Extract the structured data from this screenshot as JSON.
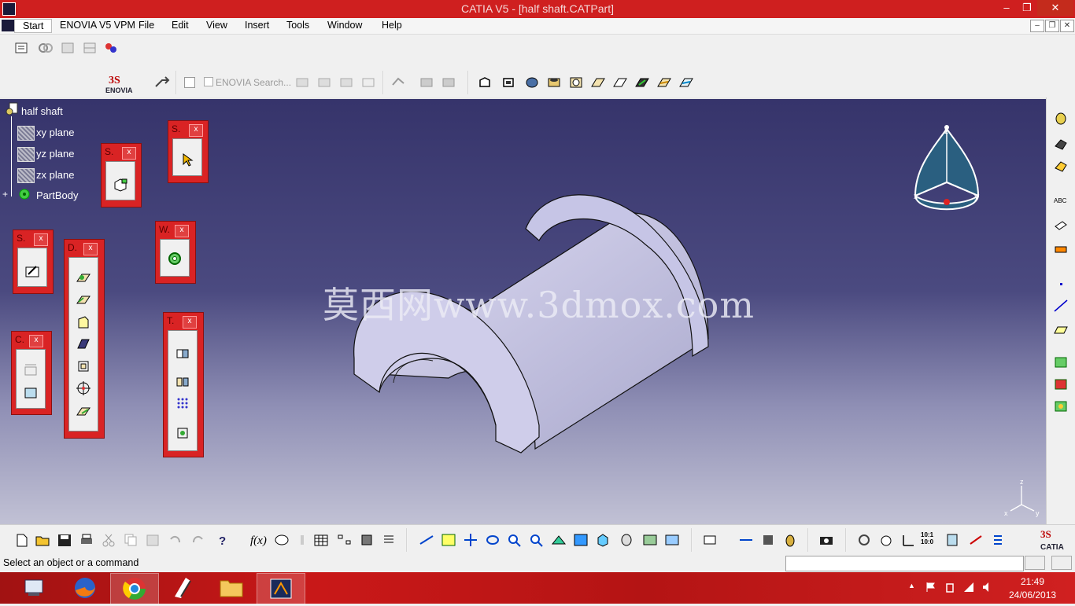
{
  "window": {
    "title": "CATIA V5 - [half shaft.CATPart]",
    "minimize_glyph": "–",
    "restore_glyph": "❐",
    "close_glyph": "✕"
  },
  "menubar": {
    "items": [
      {
        "label": "Start"
      },
      {
        "label": "ENOVIA V5 VPM"
      },
      {
        "label": "File"
      },
      {
        "label": "Edit"
      },
      {
        "label": "View"
      },
      {
        "label": "Insert"
      },
      {
        "label": "Tools"
      },
      {
        "label": "Window"
      },
      {
        "label": "Help"
      }
    ],
    "doc_min": "–",
    "doc_restore": "❐",
    "doc_close": "✕"
  },
  "toolbar": {
    "enovia_search_label": "ENOVIA Search...",
    "enovia_logo_text": "ENOVIA"
  },
  "tree": {
    "root": "half shaft",
    "items": [
      {
        "label": "xy plane"
      },
      {
        "label": "yz plane"
      },
      {
        "label": "zx plane"
      },
      {
        "label": "PartBody"
      }
    ]
  },
  "floating_toolbars": [
    {
      "title": "S.",
      "close": "x"
    },
    {
      "title": "S.",
      "close": "x"
    },
    {
      "title": "S.",
      "close": "x"
    },
    {
      "title": "D.",
      "close": "x"
    },
    {
      "title": "W.",
      "close": "x"
    },
    {
      "title": "C.",
      "close": "x"
    },
    {
      "title": "T.",
      "close": "x"
    }
  ],
  "viewport": {
    "watermark": "莫西网www.3dmox.com",
    "compass": {
      "z": "z",
      "x": "x",
      "y": "y"
    },
    "axis": {
      "z": "z",
      "x": "x",
      "y": "y"
    }
  },
  "bottom_toolbar": {
    "catia_logo_text": "CATIA",
    "fx_label": "f(x)",
    "scale_label": "10:1 10:0"
  },
  "status": {
    "text": "Select an object or a command",
    "command_value": ""
  },
  "taskbar": {
    "time": "21:49",
    "date": "24/06/2013"
  },
  "colors": {
    "titlebar": "#cf1f1f",
    "viewport_top": "#36346b",
    "viewport_bottom": "#c2c2d5",
    "part_fill": "#c9c8e8",
    "floating_toolbar": "#d92324"
  }
}
